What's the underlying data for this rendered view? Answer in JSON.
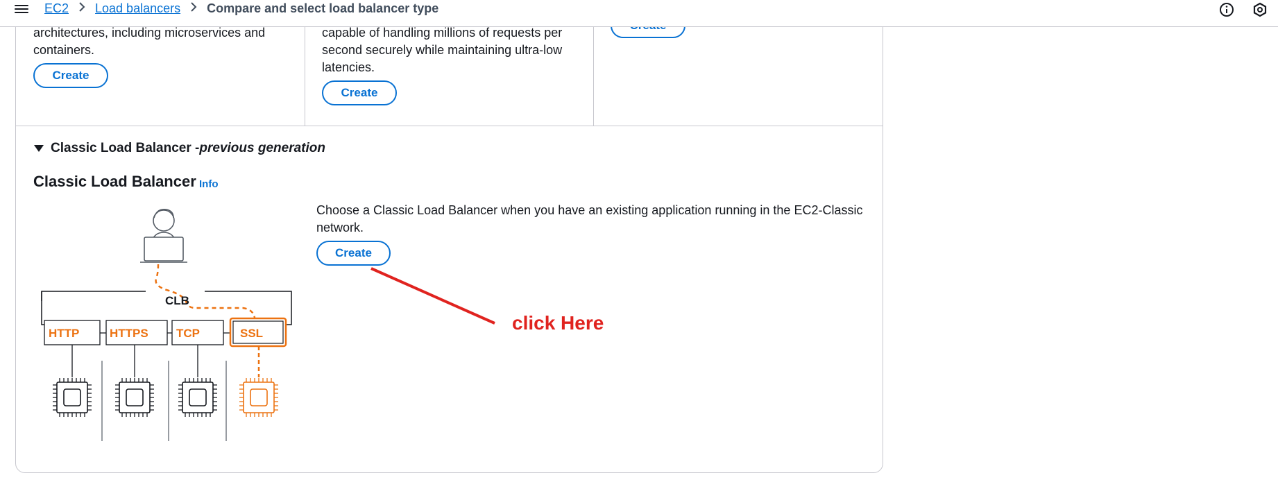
{
  "breadcrumb": {
    "items": [
      "EC2",
      "Load balancers"
    ],
    "current": "Compare and select load balancer type"
  },
  "icons": {
    "menu": "hamburger-menu-icon",
    "info": "info-circle-icon",
    "settings": "hexagon-settings-icon",
    "separator": "chevron-right-icon"
  },
  "cards_top": {
    "col1_desc": [
      "architectures, including microservices and",
      "containers."
    ],
    "col1_button": "Create",
    "col2_desc": [
      "capable of handling millions of requests per",
      "second securely while maintaining ultra-low",
      "latencies."
    ],
    "col2_button": "Create",
    "col3_button": "Create"
  },
  "classic": {
    "expander_label": "Classic Load Balancer - ",
    "expander_italic": "previous generation",
    "title": "Classic Load Balancer",
    "info": "Info",
    "description": [
      "Choose a Classic Load Balancer when you have an existing application running in the EC2-Classic",
      "network."
    ],
    "create_button": "Create"
  },
  "diagram": {
    "clb_label": "CLB",
    "protocols": [
      "HTTP",
      "HTTPS",
      "TCP",
      "SSL"
    ],
    "highlighted_protocol": "SSL"
  },
  "annotation": {
    "text": "click Here"
  },
  "colors": {
    "link": "#0972d3",
    "accent_orange": "#ec7211",
    "annotation_red": "#e0231f",
    "border": "#c6c6cd"
  }
}
